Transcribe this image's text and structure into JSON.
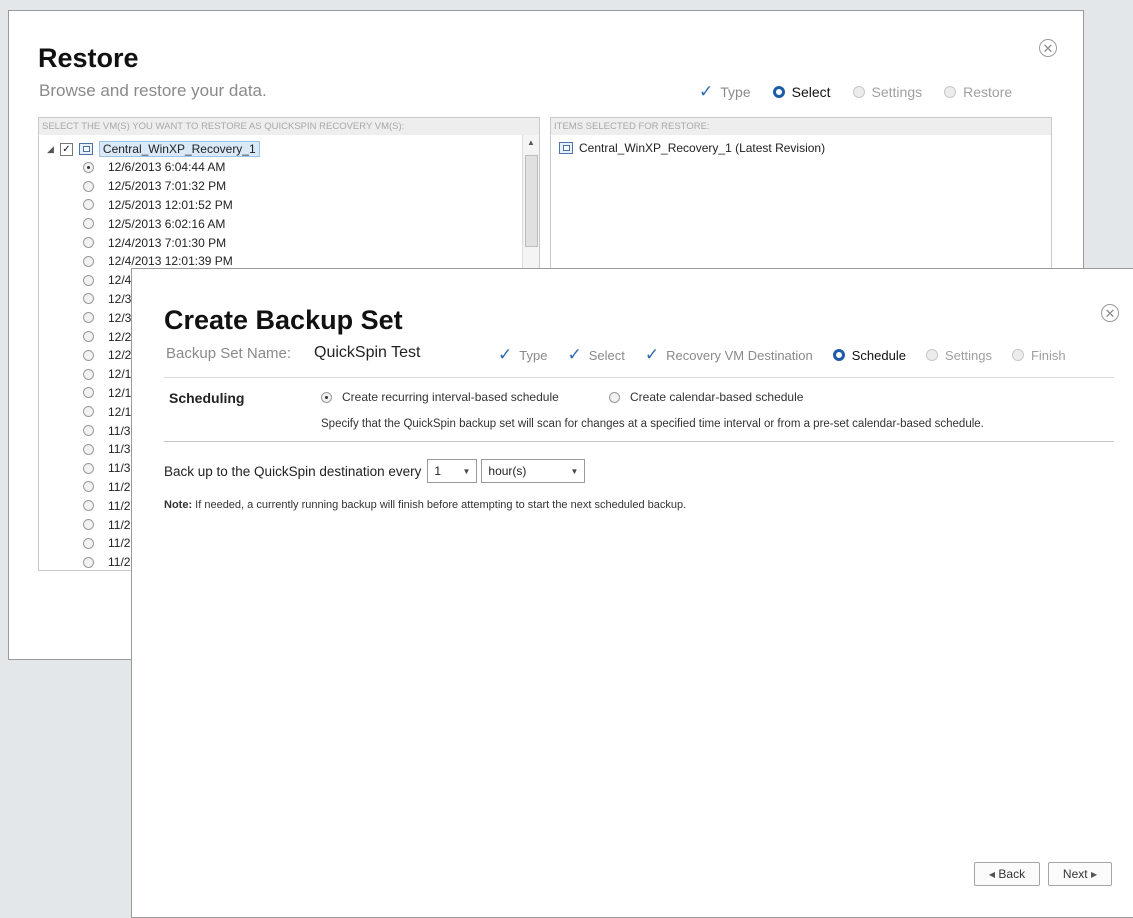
{
  "restore": {
    "title": "Restore",
    "subtitle": "Browse and restore your data.",
    "close_glyph": "✕",
    "steps": [
      {
        "label": "Type",
        "state": "done"
      },
      {
        "label": "Select",
        "state": "active"
      },
      {
        "label": "Settings",
        "state": "inactive"
      },
      {
        "label": "Restore",
        "state": "inactive"
      }
    ],
    "vm_panel_header": "SELECT THE VM(S) YOU WANT TO RESTORE AS QUICKSPIN RECOVERY VM(S):",
    "items_panel_header": "ITEMS SELECTED FOR RESTORE:",
    "vm_name": "Central_WinXP_Recovery_1",
    "revisions": [
      "12/6/2013 6:04:44 AM",
      "12/5/2013 7:01:32 PM",
      "12/5/2013 12:01:52 PM",
      "12/5/2013 6:02:16 AM",
      "12/4/2013 7:01:30 PM",
      "12/4/2013 12:01:39 PM",
      "12/4",
      "12/3",
      "12/3",
      "12/2",
      "12/2",
      "12/1",
      "12/1",
      "12/1",
      "11/3",
      "11/3",
      "11/3",
      "11/2",
      "11/2",
      "11/2",
      "11/2",
      "11/2"
    ],
    "selected_item": "Central_WinXP_Recovery_1 (Latest Revision)"
  },
  "backup": {
    "title": "Create Backup Set",
    "close_glyph": "✕",
    "set_name_label": "Backup Set Name:",
    "set_name": "QuickSpin Test",
    "steps": [
      {
        "label": "Type",
        "state": "done"
      },
      {
        "label": "Select",
        "state": "done"
      },
      {
        "label": "Recovery VM Destination",
        "state": "done"
      },
      {
        "label": "Schedule",
        "state": "active"
      },
      {
        "label": "Settings",
        "state": "inactive"
      },
      {
        "label": "Finish",
        "state": "inactive"
      }
    ],
    "scheduling_label": "Scheduling",
    "option_interval": "Create recurring interval-based schedule",
    "option_calendar": "Create calendar-based schedule",
    "description": "Specify that the QuickSpin backup set will scan for changes at a specified time interval or from a pre-set calendar-based schedule.",
    "interval_label": "Back up to the QuickSpin destination every",
    "interval_value": "1",
    "interval_unit": "hour(s)",
    "note_label": "Note:",
    "note_text": "If needed, a currently running backup will finish before attempting to start the next scheduled backup.",
    "back_label": "Back",
    "next_label": "Next"
  },
  "colors": {
    "accent": "#1f5ca8",
    "check": "#2b6cb0",
    "background": "#e4e7ea"
  }
}
